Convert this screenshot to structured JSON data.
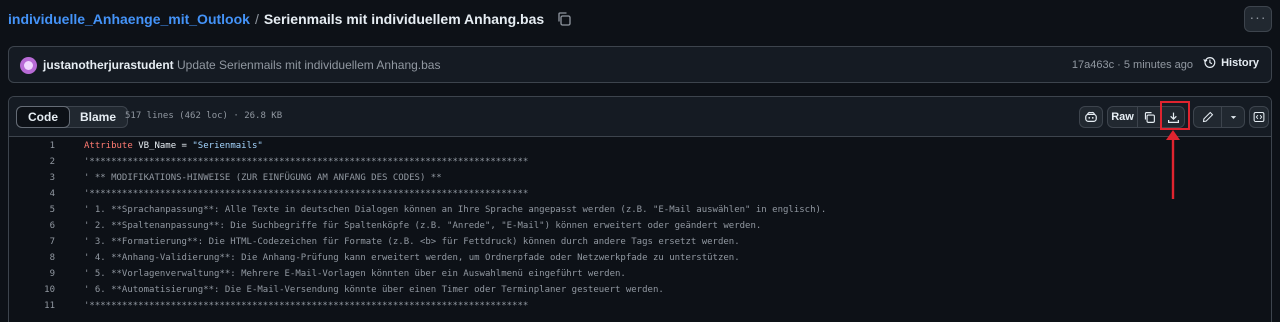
{
  "breadcrumb": {
    "repo": "individuelle_Anhaenge_mit_Outlook",
    "separator": "/",
    "file": "Serienmails mit individuellem Anhang.bas"
  },
  "header": {
    "more_label": "···"
  },
  "commit": {
    "author": "justanotherjurastudent",
    "message": "Update Serienmails mit individuellem Anhang.bas",
    "meta": "17a463c · 5 minutes ago",
    "history_label": "History"
  },
  "file": {
    "tab_code": "Code",
    "tab_blame": "Blame",
    "info": "517 lines (462 loc) · 26.8 KB",
    "raw_label": "Raw"
  },
  "code_lines": [
    {
      "n": "1",
      "kw": "Attribute",
      "ident": " VB_Name = ",
      "str": "\"Serienmails\"",
      "text": ""
    },
    {
      "n": "2",
      "kw": "",
      "ident": "",
      "str": "",
      "text": "'*********************************************************************************"
    },
    {
      "n": "3",
      "kw": "",
      "ident": "",
      "str": "",
      "text": "' ** MODIFIKATIONS-HINWEISE (ZUR EINFÜGUNG AM ANFANG DES CODES) **"
    },
    {
      "n": "4",
      "kw": "",
      "ident": "",
      "str": "",
      "text": "'*********************************************************************************"
    },
    {
      "n": "5",
      "kw": "",
      "ident": "",
      "str": "",
      "text": "' 1. **Sprachanpassung**: Alle Texte in deutschen Dialogen können an Ihre Sprache angepasst werden (z.B. \"E-Mail auswählen\" in englisch)."
    },
    {
      "n": "6",
      "kw": "",
      "ident": "",
      "str": "",
      "text": "' 2. **Spaltenanpassung**: Die Suchbegriffe für Spaltenköpfe (z.B. \"Anrede\", \"E-Mail\") können erweitert oder geändert werden."
    },
    {
      "n": "7",
      "kw": "",
      "ident": "",
      "str": "",
      "text": "' 3. **Formatierung**: Die HTML-Codezeichen für Formate (z.B. <b> für Fettdruck) können durch andere Tags ersetzt werden."
    },
    {
      "n": "8",
      "kw": "",
      "ident": "",
      "str": "",
      "text": "' 4. **Anhang-Validierung**: Die Anhang-Prüfung kann erweitert werden, um Ordnerpfade oder Netzwerkpfade zu unterstützen."
    },
    {
      "n": "9",
      "kw": "",
      "ident": "",
      "str": "",
      "text": "' 5. **Vorlagenverwaltung**: Mehrere E-Mail-Vorlagen könnten über ein Auswahlmenü eingeführt werden."
    },
    {
      "n": "10",
      "kw": "",
      "ident": "",
      "str": "",
      "text": "' 6. **Automatisierung**: Die E-Mail-Versendung könnte über einen Timer oder Terminplaner gesteuert werden."
    },
    {
      "n": "11",
      "kw": "",
      "ident": "",
      "str": "",
      "text": "'*********************************************************************************"
    }
  ],
  "colors": {
    "background": "#0d1117",
    "link": "#4493f8",
    "annotation_red": "#e0242f",
    "keyword": "#ff7b72",
    "string": "#a5d6ff"
  },
  "icons": [
    "copy-icon",
    "kebab-icon",
    "avatar",
    "history-icon",
    "copilot-icon",
    "copy-icon",
    "download-icon",
    "pencil-icon",
    "chevron-down-icon",
    "symbols-icon",
    "arrow-annotation"
  ]
}
